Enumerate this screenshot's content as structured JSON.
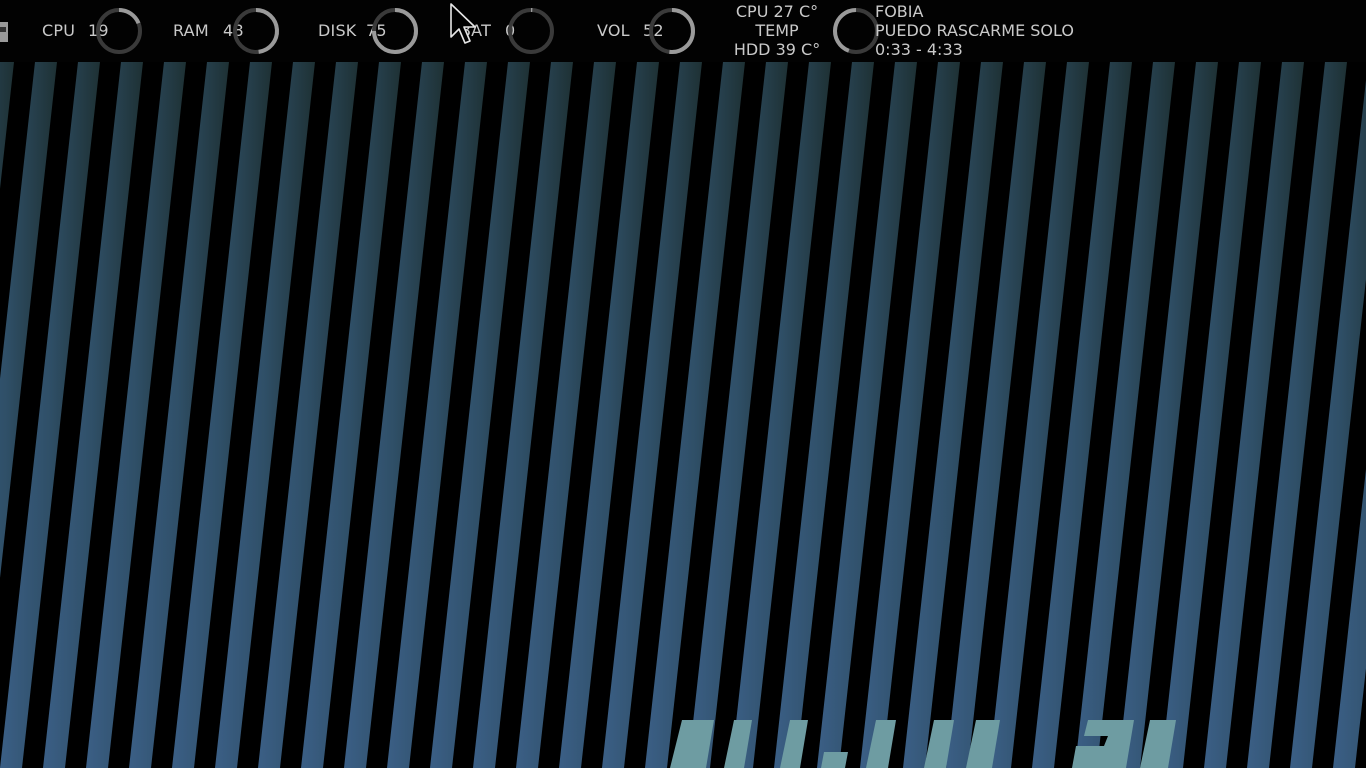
{
  "topbar": {
    "metrics": [
      {
        "label": "CPU",
        "value": "19",
        "percent": 19
      },
      {
        "label": "RAM",
        "value": "48",
        "percent": 48
      },
      {
        "label": "DISK",
        "value": "75",
        "percent": 75
      },
      {
        "label": "BAT",
        "value": "0",
        "percent": 0
      },
      {
        "label": "VOL",
        "value": "52",
        "percent": 52
      }
    ],
    "temps": {
      "cpu": "CPU 27 C°",
      "label": "TEMP",
      "hdd": "HDD 39 C°"
    },
    "music": {
      "artist": "FOBIA",
      "title": "PUEDO RASCARME SOLO",
      "time": "0:33 - 4:33",
      "percent": 12
    }
  },
  "colors": {
    "bar_bg": "#020202",
    "text": "#c9c9c9",
    "ring_fg": "#9a9a9a",
    "ring_bg": "#3a3a3a",
    "stripe_left": "#3b5f86",
    "stripe_right": "#1f3336",
    "accent_teal": "#6e9ca2"
  },
  "icons": {
    "tray": "tray-icon",
    "pointer": "mouse-pointer-icon"
  }
}
